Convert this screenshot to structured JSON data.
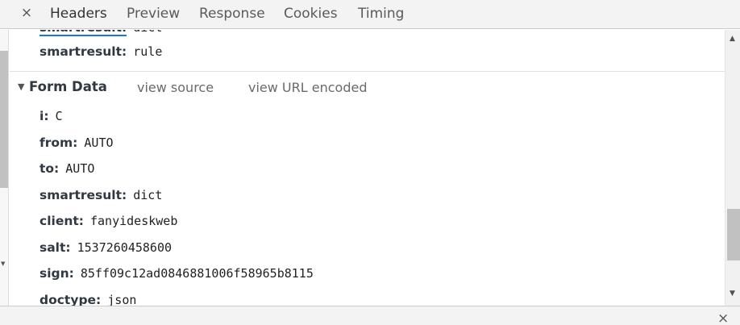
{
  "tabs": {
    "close_glyph": "×",
    "items": [
      {
        "label": "Headers",
        "active": true
      },
      {
        "label": "Preview",
        "active": false
      },
      {
        "label": "Response",
        "active": false
      },
      {
        "label": "Cookies",
        "active": false
      },
      {
        "label": "Timing",
        "active": false
      }
    ]
  },
  "top_rows": [
    {
      "key": "smartresult:",
      "value": "rule"
    }
  ],
  "form_data": {
    "title": "Form Data",
    "view_source": "view source",
    "view_url_encoded": "view URL encoded",
    "rows": [
      {
        "key": "i:",
        "value": "C"
      },
      {
        "key": "from:",
        "value": "AUTO"
      },
      {
        "key": "to:",
        "value": "AUTO"
      },
      {
        "key": "smartresult:",
        "value": "dict"
      },
      {
        "key": "client:",
        "value": "fanyideskweb"
      },
      {
        "key": "salt:",
        "value": "1537260458600"
      },
      {
        "key": "sign:",
        "value": "85ff09c12ad0846881006f58965b8115"
      },
      {
        "key": "doctype:",
        "value": "json"
      }
    ]
  },
  "drawer": {
    "close_glyph": "×"
  },
  "colors": {
    "link": "#6a6a6a",
    "key": "#303942",
    "tabbar_bg": "#f3f3f3",
    "scroll_thumb": "#c1c1c1"
  }
}
